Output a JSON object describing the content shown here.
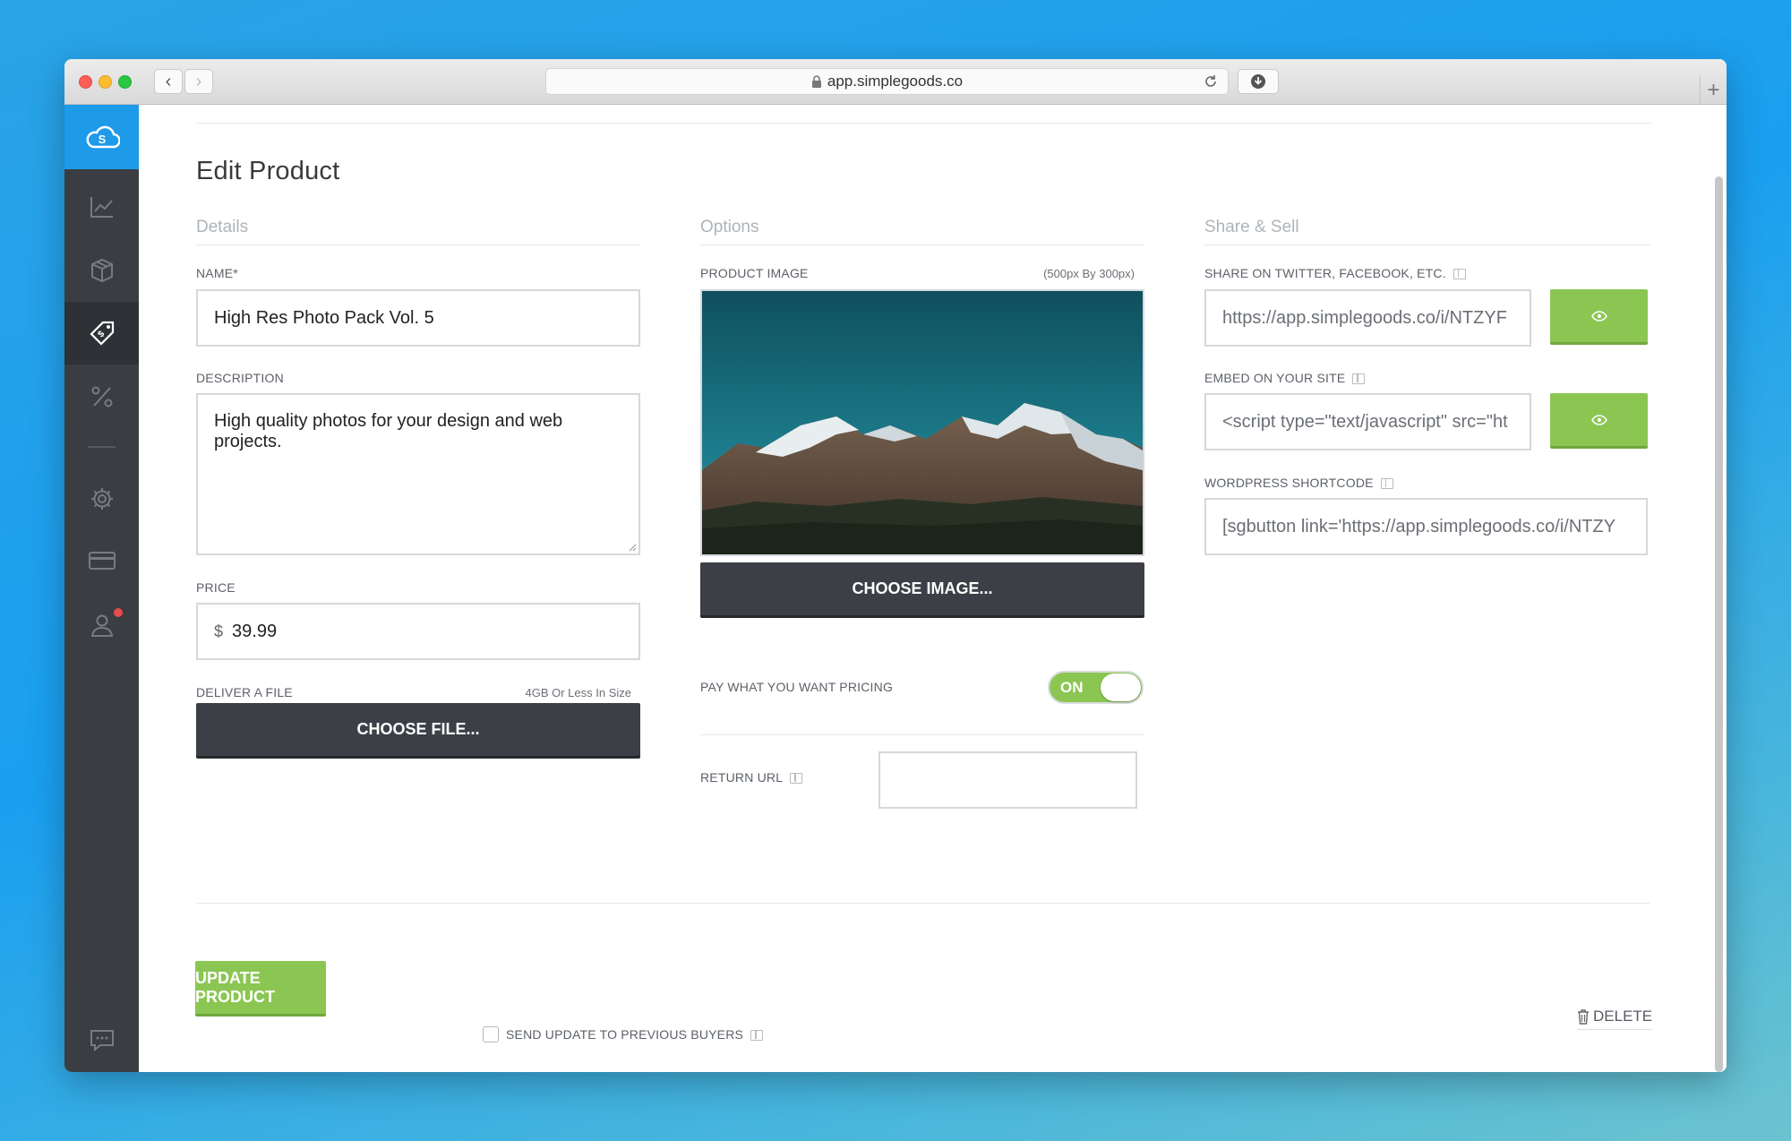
{
  "browser": {
    "url": "app.simplegoods.co",
    "back": "‹",
    "forward": "›",
    "new_tab": "+"
  },
  "page": {
    "title": "Edit Product"
  },
  "details": {
    "heading": "Details",
    "name_label": "NAME*",
    "name_value": "High Res Photo Pack Vol. 5",
    "description_label": "DESCRIPTION",
    "description_value": "High quality photos for your design and web projects.",
    "price_label": "PRICE",
    "currency": "$",
    "price_value": "39.99",
    "file_label": "DELIVER A FILE",
    "file_hint": "4GB Or Less In Size",
    "choose_file": "CHOOSE FILE..."
  },
  "options": {
    "heading": "Options",
    "image_label": "PRODUCT IMAGE",
    "image_hint": "(500px By 300px)",
    "choose_image": "CHOOSE IMAGE...",
    "pwyw_label": "PAY WHAT YOU WANT PRICING",
    "pwyw_state": "ON",
    "return_url_label": "RETURN URL",
    "return_url_value": ""
  },
  "share": {
    "heading": "Share & Sell",
    "social_label": "SHARE ON TWITTER, FACEBOOK, ETC.",
    "social_value": "https://app.simplegoods.co/i/NTZYF",
    "embed_label": "EMBED ON YOUR SITE",
    "embed_value": "<script type=\"text/javascript\" src=\"ht",
    "wp_label": "WORDPRESS SHORTCODE",
    "wp_value": "[sgbutton link='https://app.simplegoods.co/i/NTZY"
  },
  "footer": {
    "update_button": "UPDATE PRODUCT",
    "send_update_label": "SEND UPDATE TO PREVIOUS BUYERS",
    "delete_label": "DELETE"
  },
  "colors": {
    "accent_blue": "#1d9ae8",
    "green": "#8bc653",
    "sidebar": "#3a3d42",
    "dark_button": "#3c3f45",
    "notification": "#e84b4b"
  },
  "icons": [
    "cloud-logo-icon",
    "analytics-icon",
    "box-icon",
    "tag-icon",
    "percent-icon",
    "gear-icon",
    "credit-card-icon",
    "user-icon",
    "chat-icon",
    "eye-icon",
    "trash-icon",
    "lock-icon",
    "reload-icon",
    "download-icon"
  ]
}
